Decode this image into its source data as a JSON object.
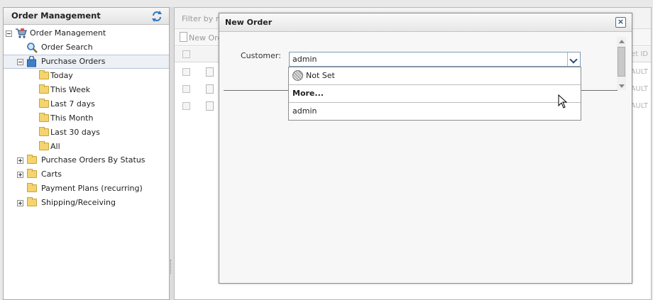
{
  "left_panel": {
    "title": "Order Management",
    "refresh_icon": "refresh-icon",
    "tree": [
      {
        "label": "Order Management",
        "icon": "cart-icon",
        "toggle": "minus"
      },
      {
        "label": "Order Search",
        "icon": "magnifier-icon",
        "toggle": "none"
      },
      {
        "label": "Purchase Orders",
        "icon": "bag-icon",
        "toggle": "minus",
        "selected": true
      },
      {
        "label": "Today",
        "icon": "folder-icon",
        "toggle": "none"
      },
      {
        "label": "This Week",
        "icon": "folder-icon",
        "toggle": "none"
      },
      {
        "label": "Last 7 days",
        "icon": "folder-icon",
        "toggle": "none"
      },
      {
        "label": "This Month",
        "icon": "folder-icon",
        "toggle": "none"
      },
      {
        "label": "Last 30 days",
        "icon": "folder-icon",
        "toggle": "none"
      },
      {
        "label": "All",
        "icon": "folder-icon",
        "toggle": "none"
      },
      {
        "label": "Purchase Orders By Status",
        "icon": "folder-icon",
        "toggle": "plus"
      },
      {
        "label": "Carts",
        "icon": "folder-icon",
        "toggle": "plus"
      },
      {
        "label": "Payment Plans (recurring)",
        "icon": "folder-icon",
        "toggle": "none"
      },
      {
        "label": "Shipping/Receiving",
        "icon": "folder-icon",
        "toggle": "plus"
      }
    ]
  },
  "right_panel": {
    "filter_placeholder": "Filter by n",
    "toolbar_new_label": "New Ord",
    "column_partial": "et ID",
    "row_partial": "AULT",
    "rows": 3
  },
  "dialog": {
    "title": "New Order",
    "close_icon": "close-icon",
    "customer_label": "Customer:",
    "customer_value": "admin",
    "dropdown_items": [
      {
        "label": "Not Set",
        "icon": "not-set-icon"
      },
      {
        "label": "More...",
        "bold": true
      },
      {
        "label": "admin"
      }
    ]
  },
  "colors": {
    "accent": "#2c4d75",
    "folder": "#f5d36e",
    "selection": "#edf1f6"
  }
}
